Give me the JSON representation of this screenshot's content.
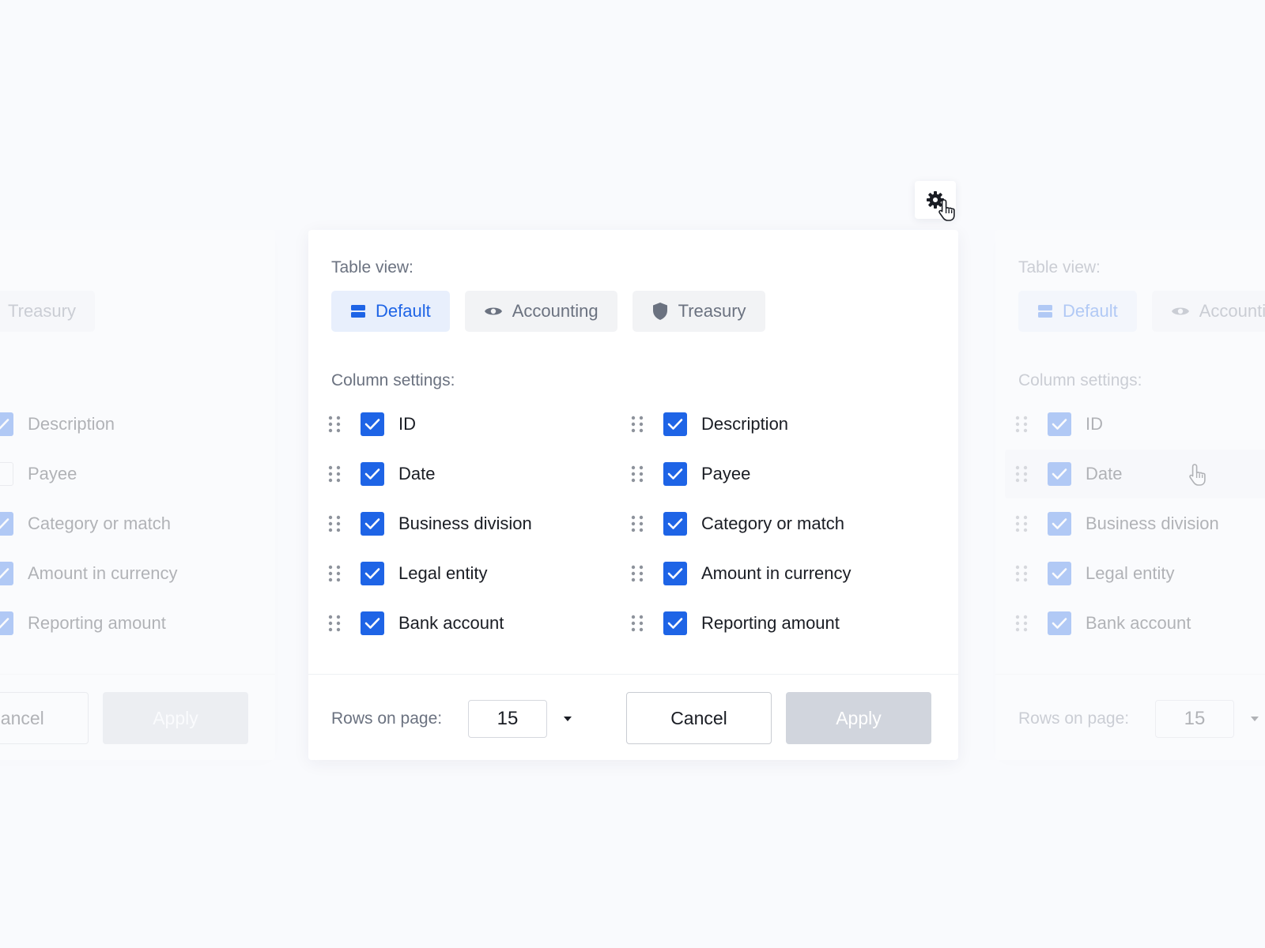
{
  "panel": {
    "table_view_label": "Table view:",
    "column_settings_label": "Column settings:",
    "tabs": [
      {
        "label": "Default",
        "icon": "rows-icon",
        "active": true
      },
      {
        "label": "Accounting",
        "icon": "eye-icon",
        "active": false
      },
      {
        "label": "Treasury",
        "icon": "shield-icon",
        "active": false
      }
    ],
    "columns_left": [
      {
        "label": "ID",
        "checked": true
      },
      {
        "label": "Date",
        "checked": true
      },
      {
        "label": "Business division",
        "checked": true
      },
      {
        "label": "Legal entity",
        "checked": true
      },
      {
        "label": "Bank account",
        "checked": true
      }
    ],
    "columns_right": [
      {
        "label": "Description",
        "checked": true
      },
      {
        "label": "Payee",
        "checked": true
      },
      {
        "label": "Category or match",
        "checked": true
      },
      {
        "label": "Amount in currency",
        "checked": true
      },
      {
        "label": "Reporting amount",
        "checked": true
      }
    ],
    "footer": {
      "rows_label": "Rows on page:",
      "rows_value": "15",
      "cancel_label": "Cancel",
      "apply_label": "Apply"
    }
  },
  "ghost_left": {
    "tab_treasury": "Treasury",
    "columns": [
      "Description",
      "Payee",
      "Category or match",
      "Amount in currency",
      "Reporting amount"
    ],
    "checked": [
      true,
      false,
      true,
      true,
      true
    ],
    "cancel_label": "Cancel",
    "apply_label": "Apply"
  },
  "ghost_right": {
    "table_view_label": "Table view:",
    "column_settings_label": "Column settings:",
    "tab_default": "Default",
    "tab_accounting": "Accounting",
    "columns": [
      "ID",
      "Date",
      "Business division",
      "Legal entity",
      "Bank account"
    ],
    "rows_label": "Rows on page:",
    "rows_value": "15"
  },
  "colors": {
    "accent": "#1e64e6",
    "accent_bg": "#e8effc",
    "muted_text": "#6b7280",
    "disabled_button": "#d1d5dd"
  },
  "icons": {
    "settings": "gear-icon",
    "cursor": "hand-pointer-icon",
    "drag": "drag-handle-icon"
  }
}
